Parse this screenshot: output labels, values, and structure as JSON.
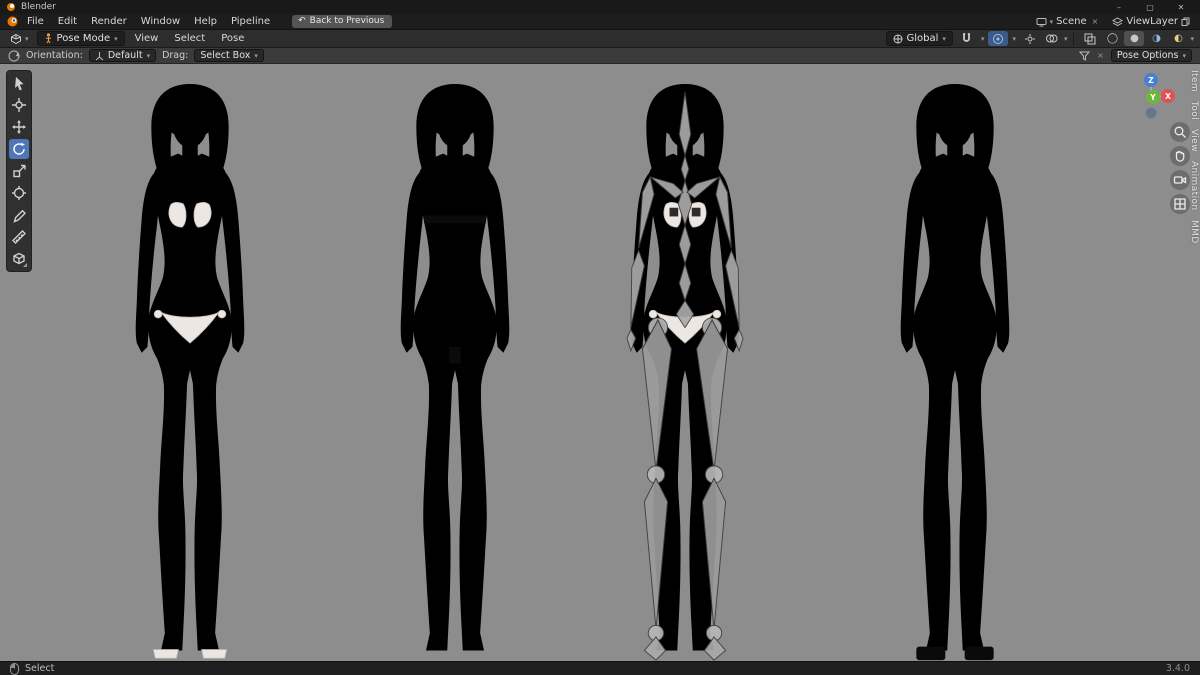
{
  "window": {
    "title": "Blender",
    "controls": [
      "–",
      "▢",
      "✕"
    ]
  },
  "menubar": {
    "items": [
      "File",
      "Edit",
      "Render",
      "Window",
      "Help",
      "Pipeline"
    ],
    "back_button": "Back to Previous",
    "scene": "Scene",
    "viewlayer": "ViewLayer"
  },
  "toolheader": {
    "mode": "Pose Mode",
    "menus": [
      "View",
      "Select",
      "Pose"
    ],
    "orientation": "Global"
  },
  "subheader": {
    "orientation_label": "Orientation:",
    "orientation_value": "Default",
    "drag_label": "Drag:",
    "drag_value": "Select Box",
    "pose_options": "Pose Options"
  },
  "tools": {
    "names": [
      "Tweak",
      "Select Box",
      "Cursor",
      "Move",
      "Rotate",
      "Scale",
      "Transform",
      "Annotate",
      "Measure"
    ],
    "active": "Rotate"
  },
  "sidebar_tabs": [
    "Item",
    "Tool",
    "View",
    "Animation",
    "MMD"
  ],
  "gizmo": {
    "x": "X",
    "y": "Y",
    "z": "Z"
  },
  "viewport": {
    "figures": [
      "textured model with underwear",
      "nude model with censor bars",
      "model with armature bones",
      "dark wireframe model"
    ]
  },
  "statusbar": {
    "mode": "Select",
    "version": "3.4.0"
  },
  "colors": {
    "accent": "#4f76b8",
    "axis_x": "#e05252",
    "axis_y": "#6fb63c",
    "axis_z": "#4a7fd0",
    "viewport_bg": "#8d8d8d",
    "skin": "#f1dad2",
    "hair": "#d9c08c",
    "dark_skin": "#161616",
    "dark_hair": "#0a0a0a"
  }
}
